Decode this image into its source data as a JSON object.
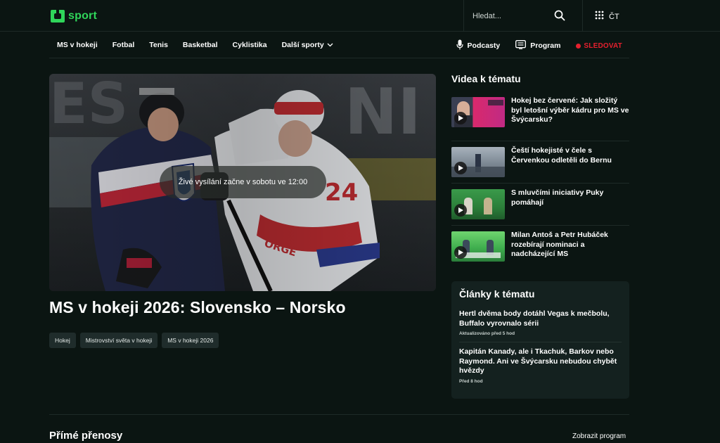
{
  "brand": {
    "logo_text": "sport",
    "accent": "#2fd65a"
  },
  "search": {
    "placeholder": "Hledat..."
  },
  "apps": {
    "label": "ČT"
  },
  "nav": {
    "items": [
      {
        "label": "MS v hokeji"
      },
      {
        "label": "Fotbal"
      },
      {
        "label": "Tenis"
      },
      {
        "label": "Basketbal"
      },
      {
        "label": "Cyklistika"
      },
      {
        "label": "Další sporty"
      }
    ],
    "podcasts": "Podcasty",
    "program": "Program",
    "follow": "SLEDOVAT",
    "live_color": "#e5202e"
  },
  "hero": {
    "live_notice": "Živé vysílání začne v sobotu ve 12:00",
    "title": "MS v hokeji 2026: Slovensko – Norsko",
    "tags": [
      "Hokej",
      "Mistrovství světa v hokeji",
      "MS v hokeji 2026"
    ]
  },
  "videos": {
    "heading": "Videa k tématu",
    "items": [
      {
        "title": "Hokej bez červené: Jak složitý byl letošní výběr kádru pro MS ve Švýcarsku?"
      },
      {
        "title": "Čeští hokejisté v čele s Červenkou odletěli do Bernu"
      },
      {
        "title": "S mluvčími iniciativy Puky pomáhají"
      },
      {
        "title": "Milan Antoš a Petr Hubáček rozebírají nominaci a nadcházející MS"
      }
    ]
  },
  "articles": {
    "heading": "Články k tématu",
    "items": [
      {
        "title": "Hertl dvěma body dotáhl Vegas k mečbolu, Buffalo vyrovnalo sérii",
        "meta": "Aktualizováno před 5 hod"
      },
      {
        "title": "Kapitán Kanady, ale i Tkachuk, Barkov nebo Raymond. Ani ve Švýcarsku nebudou chybět hvězdy",
        "meta": "Před 8 hod"
      }
    ]
  },
  "live": {
    "heading": "Přímé přenosy",
    "link": "Zobrazit program"
  }
}
